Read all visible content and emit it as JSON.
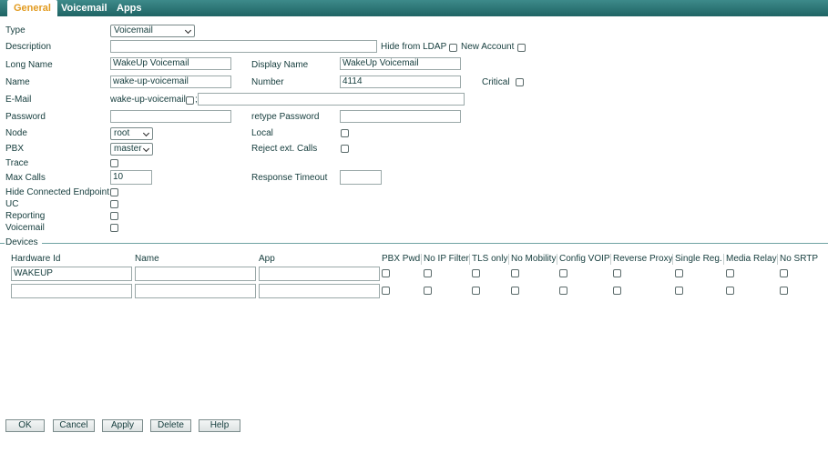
{
  "tabs": [
    {
      "label": "General"
    },
    {
      "label": "Voicemail"
    },
    {
      "label": "Apps"
    }
  ],
  "form": {
    "type_label": "Type",
    "type_value": "Voicemail",
    "description_label": "Description",
    "description_value": "",
    "hide_ldap_label": "Hide from LDAP",
    "new_account_label": "New Account",
    "long_name_label": "Long Name",
    "long_name_value": "WakeUp Voicemail",
    "display_name_label": "Display Name",
    "display_name_value": "WakeUp Voicemail",
    "name_label": "Name",
    "name_value": "wake-up-voicemail",
    "number_label": "Number",
    "number_value": "4114",
    "critical_label": "Critical",
    "email_label": "E-Mail",
    "email_prefix": "wake-up-voicemail",
    "email_separator": ";",
    "email_value": "",
    "password_label": "Password",
    "password_value": "",
    "retype_password_label": "retype Password",
    "retype_password_value": "",
    "node_label": "Node",
    "node_value": "root",
    "local_label": "Local",
    "pbx_label": "PBX",
    "pbx_value": "master",
    "reject_ext_label": "Reject ext. Calls",
    "trace_label": "Trace",
    "max_calls_label": "Max Calls",
    "max_calls_value": "10",
    "response_timeout_label": "Response Timeout",
    "response_timeout_value": "",
    "hide_connected_label": "Hide Connected Endpoint",
    "uc_label": "UC",
    "reporting_label": "Reporting",
    "voicemail_label": "Voicemail"
  },
  "devices": {
    "legend": "Devices",
    "columns": [
      "Hardware Id",
      "Name",
      "App",
      "PBX Pwd",
      "No IP Filter",
      "TLS only",
      "No Mobility",
      "Config VOIP",
      "Reverse Proxy",
      "Single Reg.",
      "Media Relay",
      "No SRTP"
    ],
    "rows": [
      {
        "hardware_id": "WAKEUP",
        "name": "",
        "app": ""
      },
      {
        "hardware_id": "",
        "name": "",
        "app": ""
      }
    ]
  },
  "buttons": {
    "ok": "OK",
    "cancel": "Cancel",
    "apply": "Apply",
    "delete": "Delete",
    "help": "Help"
  },
  "colors": {
    "tab_bar": "#2a7373",
    "active_tab_text": "#e29b20",
    "label_text": "#143c3c"
  }
}
